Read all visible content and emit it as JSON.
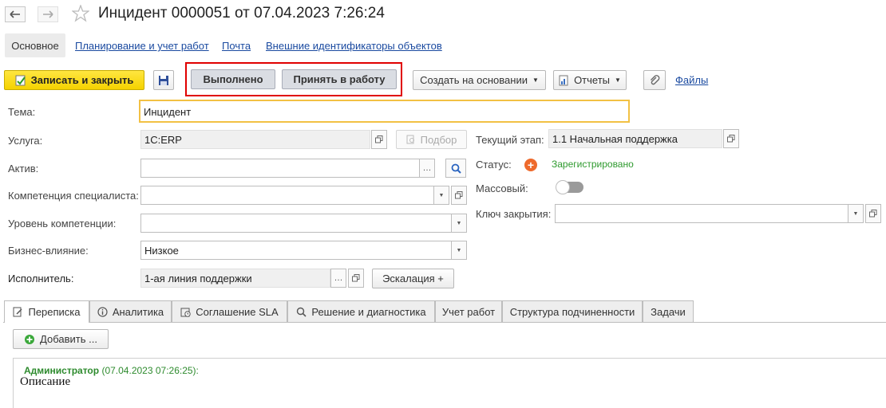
{
  "header": {
    "title": "Инцидент 0000051 от 07.04.2023 7:26:24"
  },
  "top_tabs": {
    "main": "Основное",
    "planning": "Планирование и учет работ",
    "mail": "Почта",
    "external_ids": "Внешние идентификаторы объектов"
  },
  "toolbar": {
    "save_close": "Записать и закрыть",
    "done": "Выполнено",
    "accept": "Принять в работу",
    "create_based": "Создать на основании",
    "reports": "Отчеты",
    "files": "Файлы"
  },
  "form": {
    "topic_label": "Тема:",
    "topic_value": "Инцидент",
    "service_label": "Услуга:",
    "service_value": "1С:ERP",
    "select_button": "Подбор",
    "asset_label": "Актив:",
    "asset_value": "",
    "competence_label": "Компетенция специалиста:",
    "competence_value": "",
    "level_label": "Уровень компетенции:",
    "level_value": "",
    "impact_label": "Бизнес-влияние:",
    "impact_value": "Низкое",
    "executor_label": "Исполнитель:",
    "executor_value": "1-ая линия поддержки",
    "escalation": "Эскалация +",
    "stage_label": "Текущий этап:",
    "stage_value": "1.1 Начальная поддержка",
    "status_label": "Статус:",
    "status_value": "Зарегистрировано",
    "mass_label": "Массовый:",
    "close_key_label": "Ключ закрытия:",
    "close_key_value": ""
  },
  "bottom_tabs": [
    {
      "label": "Переписка"
    },
    {
      "label": "Аналитика"
    },
    {
      "label": "Соглашение SLA"
    },
    {
      "label": "Решение и диагностика"
    },
    {
      "label": "Учет работ"
    },
    {
      "label": "Структура подчиненности"
    },
    {
      "label": "Задачи"
    }
  ],
  "correspondence": {
    "add_button": "Добавить ...",
    "author": "Администратор",
    "timestamp": "(07.04.2023 07:26:25):",
    "text": "Описание"
  },
  "colors": {
    "accent_yellow": "#f5d200",
    "highlight_red": "#e00000",
    "status_orange": "#ee6a2c",
    "status_green": "#2e9a2e",
    "link_blue": "#1a4aa0"
  }
}
